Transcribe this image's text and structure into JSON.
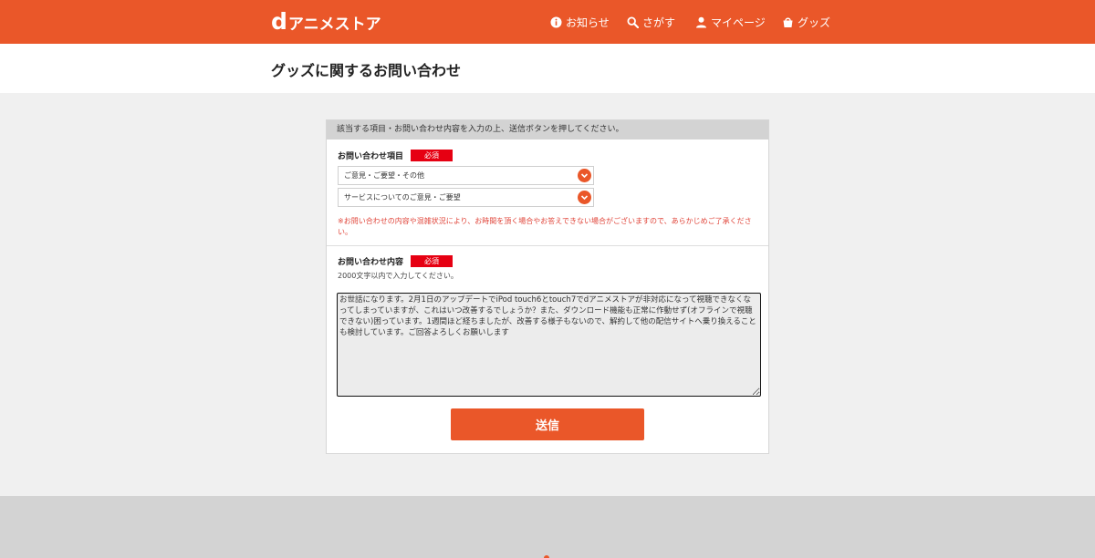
{
  "header": {
    "logo_d": "d",
    "logo_text": "アニメストア",
    "nav": [
      {
        "label": "お知らせ",
        "icon": "info-icon"
      },
      {
        "label": "さがす",
        "icon": "search-icon"
      },
      {
        "label": "マイページ",
        "icon": "user-icon"
      },
      {
        "label": "グッズ",
        "icon": "shopping-bag-icon"
      }
    ]
  },
  "page": {
    "title": "グッズに関するお問い合わせ"
  },
  "form": {
    "instruction": "該当する項目・お問い合わせ内容を入力の上、送信ボタンを押してください。",
    "category_label": "お問い合わせ項目",
    "required_label": "必須",
    "select1_value": "ご意見・ご要望・その他",
    "select2_value": "サービスについてのご意見・ご要望",
    "note": "※お問い合わせの内容や混雑状況により、お時間を頂く場合やお答えできない場合がございますので、あらかじめご了承ください。",
    "content_label": "お問い合わせ内容",
    "content_hint": "2000文字以内で入力してください。",
    "content_value": "お世話になります。2月1日のアップデートでiPod touch6とtouch7でdアニメストアが非対応になって視聴できなくなってしまっていますが、これはいつ改善するでしょうか？また、ダウンロード機能も正常に作動せず(オフラインで視聴できない)困っています。1週間ほど経ちましたが、改善する様子もないので、解約して他の配信サイトへ乗り換えることも検討しています。ご回答よろしくお願いします",
    "submit_label": "送信"
  },
  "colors": {
    "brand": "#ea5729",
    "required": "#e60012",
    "note": "#e0453a"
  }
}
